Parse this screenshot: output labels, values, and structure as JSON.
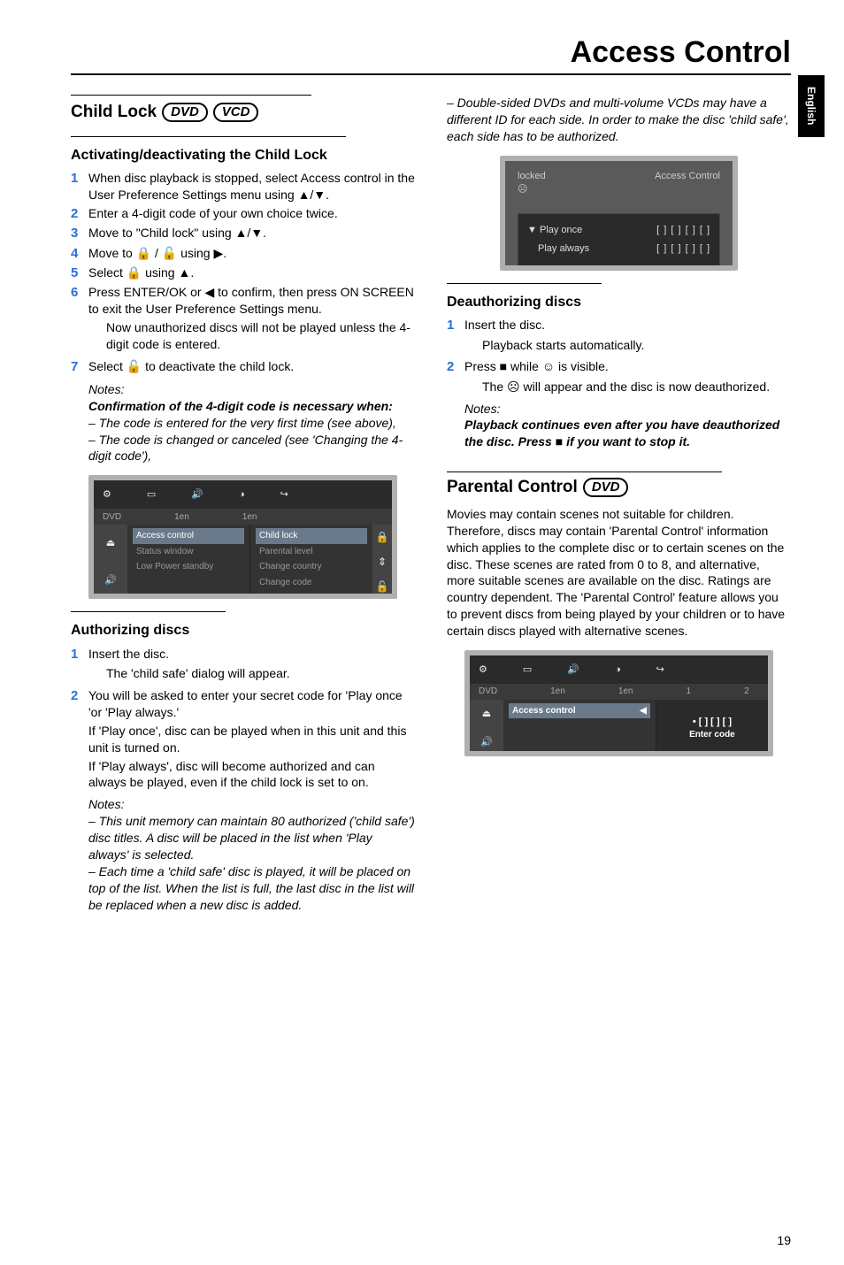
{
  "page_title": "Access Control",
  "side_tab": "English",
  "page_num": "19",
  "col1": {
    "h2": "Child Lock",
    "badges": [
      "DVD",
      "VCD"
    ],
    "sec1_h3": "Activating/deactivating the Child Lock",
    "steps1": [
      "When disc playback is stopped, select Access control in the User Preference Settings menu using ▲/▼.",
      "Enter a 4-digit code of your own choice twice.",
      "Move to \"Child lock\" using ▲/▼.",
      "Move to 🔒 / 🔓 using ▶.",
      "Select 🔒 using ▲.",
      "Press ENTER/OK or ◀ to confirm, then press ON SCREEN to exit the User Preference Settings menu."
    ],
    "step6_sub": "Now unauthorized discs will not be played unless the 4-digit code is entered.",
    "step7": "Select 🔓 to deactivate the child lock.",
    "notes1_head": "Notes:",
    "notes1_a": "Confirmation of the 4-digit code is necessary when:",
    "notes1_b": "– The code is entered for the very first time (see above),",
    "notes1_c": "– The code is changed or canceled (see 'Changing the 4-digit code'),",
    "ss1": {
      "dvd": "DVD",
      "1en_a": "1en",
      "1en_b": "1en",
      "mid": [
        "Access control",
        "Status window",
        "Low Power standby"
      ],
      "right": [
        "Child lock",
        "Parental level",
        "Change country",
        "Change code"
      ]
    },
    "sec2_h3": "Authorizing discs",
    "auth_step1": "Insert the disc.",
    "auth_step1_sub": "The 'child safe' dialog will appear.",
    "auth_step2": "You will be asked to enter your secret code for 'Play once 'or 'Play always.'",
    "auth_p1": "If 'Play once', disc can be played when in this unit and this unit is turned on.",
    "auth_p2": "If 'Play always', disc will become authorized and can always be played, even if the child lock is set to on.",
    "notes2_head": "Notes:",
    "notes2_a": "– This unit memory can maintain 80 authorized ('child safe') disc titles. A disc will be placed in the list when 'Play always' is selected.",
    "notes2_b": "– Each time a 'child safe' disc is played, it will be placed on top of the list. When the list is full, the last disc in the list will be replaced when a new disc is added."
  },
  "col2": {
    "top_note": "– Double-sided DVDs and multi-volume VCDs may have a different ID for each side. In order to make the disc 'child safe', each side has to be authorized.",
    "ss2": {
      "locked": "locked",
      "ac": "Access Control",
      "row1": "Play once",
      "row1_val": "[ ]  [ ]  [ ]  [ ]",
      "row2": "Play always",
      "row2_val": "[ ]  [ ]  [ ]  [ ]"
    },
    "sec3_h3": "Deauthorizing discs",
    "deauth_step1": "Insert the disc.",
    "deauth_step1_sub": "Playback starts automatically.",
    "deauth_step2": "Press ■ while ☺ is visible.",
    "deauth_step2_sub": "The ☹ will appear and the disc is now deauthorized.",
    "notes3_head": "Notes:",
    "notes3_a": "Playback continues even after you have deauthorized the disc. Press ■ if you want to stop it.",
    "h2b": "Parental Control",
    "h2b_badge": "DVD",
    "pc_para": "Movies may contain scenes not suitable for children. Therefore, discs may contain 'Parental Control' information which applies to the complete disc or to certain scenes on the disc. These scenes are rated from 0 to 8, and alternative, more suitable scenes are available on the disc. Ratings are country dependent. The 'Parental Control' feature allows you to prevent discs from being played by your children or to have certain discs played with alternative scenes.",
    "ss3": {
      "1en_a": "1en",
      "1en_b": "1en",
      "n1": "1",
      "n2": "2",
      "ac": "Access control",
      "code": "• [ ] [ ] [ ]",
      "enter": "Enter code"
    }
  }
}
